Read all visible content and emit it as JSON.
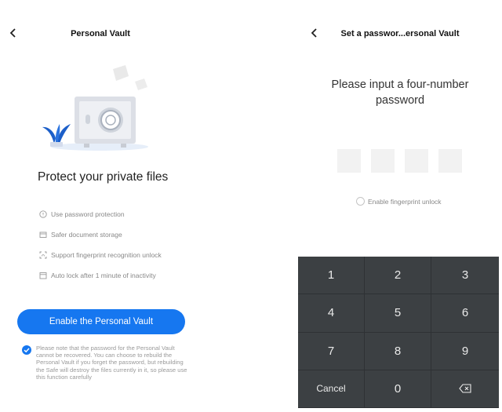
{
  "left": {
    "title": "Personal Vault",
    "heading": "Protect your private files",
    "features": [
      {
        "icon": "shield-icon",
        "label": "Use password protection"
      },
      {
        "icon": "folder-icon",
        "label": "Safer document storage"
      },
      {
        "icon": "fingerprint-icon",
        "label": "Support fingerprint recognition unlock"
      },
      {
        "icon": "calendar-lock-icon",
        "label": "Auto lock after 1 minute of inactivity"
      }
    ],
    "enable_button": "Enable the Personal Vault",
    "notice_checked": true,
    "notice": "Please note that the password for the Personal Vault cannot be recovered. You can choose to rebuild the Personal Vault if you forget the password, but rebuilding the Safe will destroy the files currently in it, so please use this function carefully"
  },
  "right": {
    "title": "Set a passwor...ersonal Vault",
    "heading": "Please input a four-number password",
    "pin_slots": 4,
    "fingerprint_label": "Enable fingerprint unlock",
    "fingerprint_enabled": false,
    "keypad": {
      "k1": "1",
      "k2": "2",
      "k3": "3",
      "k4": "4",
      "k5": "5",
      "k6": "6",
      "k7": "7",
      "k8": "8",
      "k9": "9",
      "cancel": "Cancel",
      "k0": "0",
      "backspace_icon": "backspace-icon"
    }
  },
  "colors": {
    "accent": "#1677f0",
    "keypad_bg": "#3c4043",
    "illustration_leaf": "#1c5fc9"
  }
}
